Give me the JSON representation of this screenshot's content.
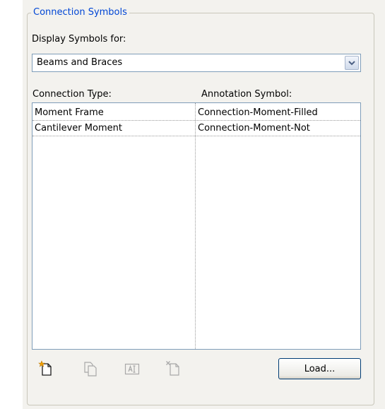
{
  "group": {
    "title": "Connection Symbols"
  },
  "display": {
    "label": "Display Symbols for:",
    "selected": "Beams and Braces"
  },
  "table": {
    "headers": [
      "Connection Type:",
      "Annotation Symbol:"
    ],
    "rows": [
      {
        "type": "Moment Frame",
        "symbol": "Connection-Moment-Filled"
      },
      {
        "type": "Cantilever Moment",
        "symbol": "Connection-Moment-Not"
      }
    ]
  },
  "toolbar": {
    "icons": [
      "new-icon",
      "duplicate-icon",
      "rename-icon",
      "delete-icon"
    ],
    "load_label": "Load..."
  },
  "colors": {
    "legend": "#0046d5",
    "panel_bg": "#f3f2ee",
    "field_border": "#7f9db9",
    "new_icon_star": "#f0a000"
  }
}
